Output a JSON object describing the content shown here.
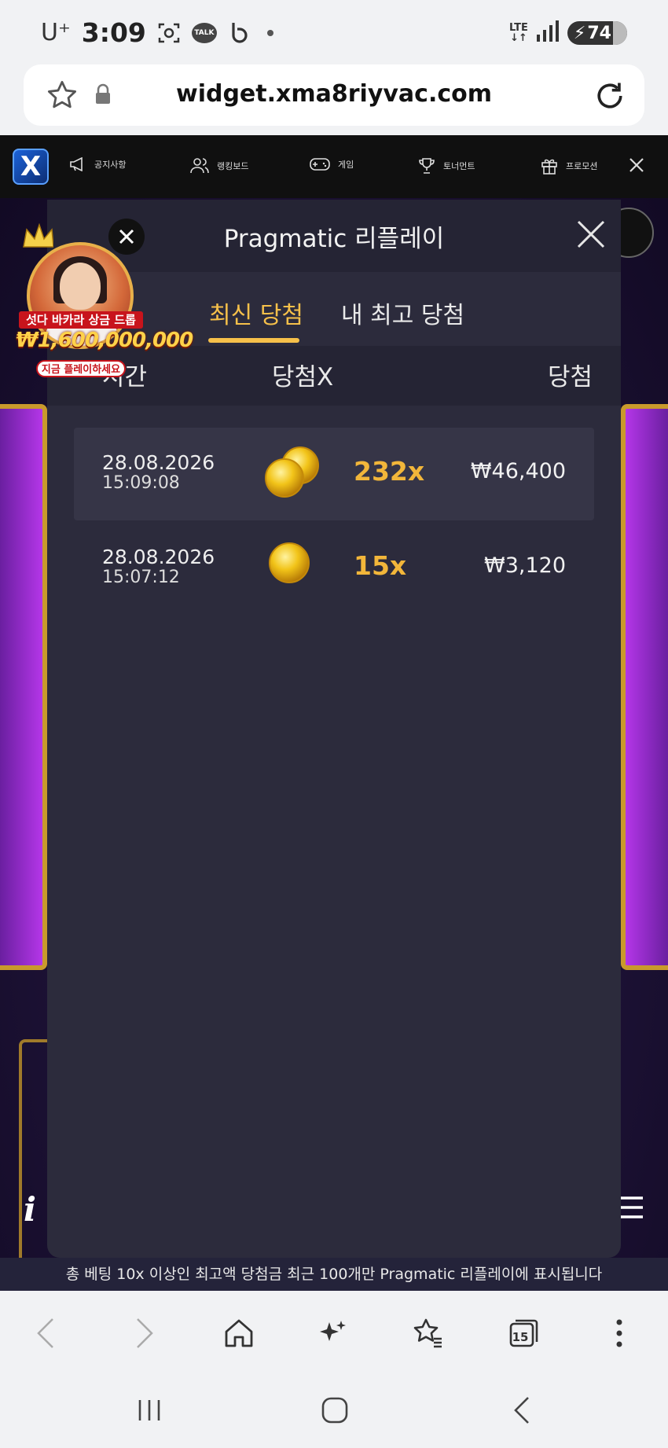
{
  "status_bar": {
    "carrier": "U⁺",
    "time": "3:09",
    "network": "LTE",
    "battery": "74"
  },
  "browser": {
    "url": "widget.xma8riyvac.com",
    "tabs_count": "15"
  },
  "site_nav": {
    "logo": "X",
    "items": [
      {
        "label": "공지사항",
        "icon": "megaphone-icon"
      },
      {
        "label": "랭킹보드",
        "icon": "users-icon"
      },
      {
        "label": "게임",
        "icon": "gamepad-icon"
      },
      {
        "label": "토너먼트",
        "icon": "trophy-icon"
      },
      {
        "label": "프로모션",
        "icon": "gift-icon"
      }
    ]
  },
  "promo": {
    "title": "섯다 바카라 상금 드롭",
    "amount": "₩1,600,000,000",
    "cta": "지금 플레이하세요"
  },
  "modal": {
    "title": "Pragmatic 리플레이",
    "tabs": [
      {
        "label": "최신 당첨",
        "active": true
      },
      {
        "label": "내 최고 당첨",
        "active": false
      }
    ],
    "columns": {
      "time": "시간",
      "multiplier": "당첨X",
      "win": "당첨"
    },
    "rows": [
      {
        "date": "28.08.2026",
        "time": "15:09:08",
        "multiplier": "232x",
        "win": "₩46,400"
      },
      {
        "date": "28.08.2026",
        "time": "15:07:12",
        "multiplier": "15x",
        "win": "₩3,120"
      }
    ],
    "footer": "총 베팅 10x 이상인 최고액 당첨금 최근 100개만 Pragmatic 리플레이에 표시됩니다"
  },
  "colors": {
    "accent": "#f6c04a",
    "modal_bg": "#2c2b3c",
    "header_bg": "#252434"
  }
}
